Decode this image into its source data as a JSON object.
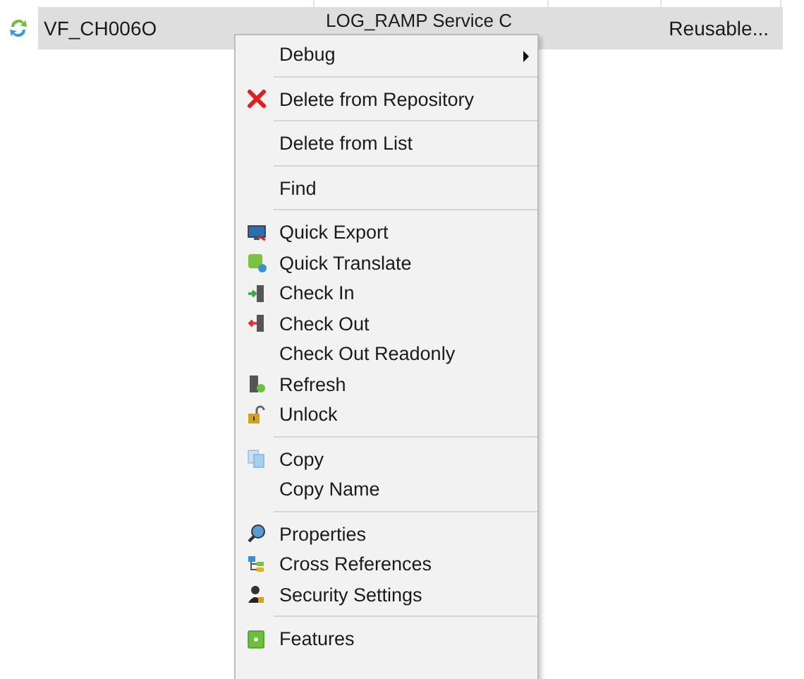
{
  "row": {
    "name": "VF_CH006O",
    "column_2": "LOG_RAMP Service C",
    "column_3": "Reusable...",
    "selected": true
  },
  "context_menu": [
    {
      "kind": "item",
      "label": "Debug",
      "submenu": true
    },
    {
      "kind": "separator"
    },
    {
      "kind": "item",
      "label": "Delete from Repository"
    },
    {
      "kind": "separator"
    },
    {
      "kind": "item",
      "label": "Delete from List"
    },
    {
      "kind": "separator"
    },
    {
      "kind": "item",
      "label": "Find"
    },
    {
      "kind": "separator"
    },
    {
      "kind": "item",
      "label": "Quick Export"
    },
    {
      "kind": "item",
      "label": "Quick Translate"
    },
    {
      "kind": "item",
      "label": "Check In"
    },
    {
      "kind": "item",
      "label": "Check Out"
    },
    {
      "kind": "item",
      "label": "Check Out Readonly"
    },
    {
      "kind": "item",
      "label": "Refresh"
    },
    {
      "kind": "item",
      "label": "Unlock"
    },
    {
      "kind": "separator"
    },
    {
      "kind": "item",
      "label": "Copy"
    },
    {
      "kind": "item",
      "label": "Copy Name"
    },
    {
      "kind": "separator"
    },
    {
      "kind": "item",
      "label": "Properties"
    },
    {
      "kind": "item",
      "label": "Cross References"
    },
    {
      "kind": "item",
      "label": "Security Settings"
    },
    {
      "kind": "separator"
    },
    {
      "kind": "item",
      "label": "Features"
    }
  ]
}
